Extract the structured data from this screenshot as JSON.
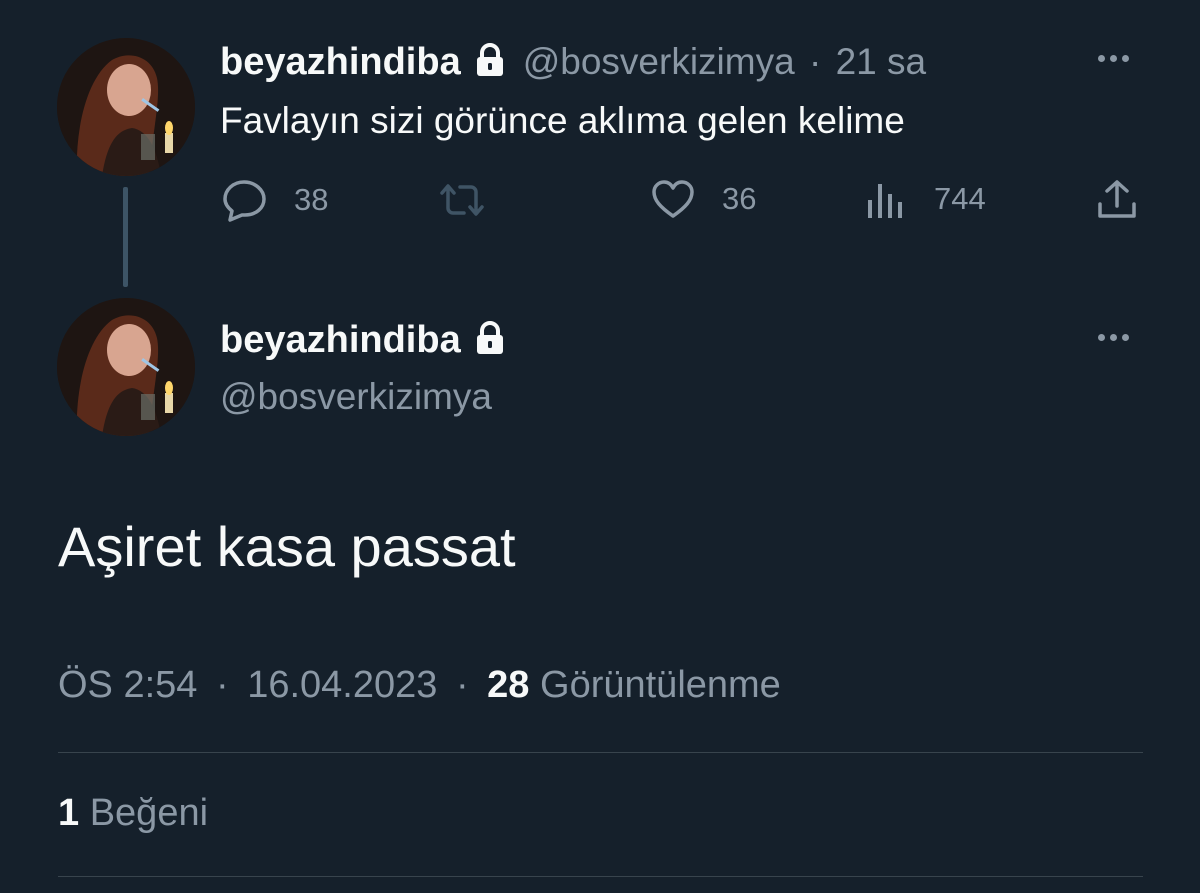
{
  "reply_tweet": {
    "display_name": "beyazhindiba",
    "handle": "@bosverkizimya",
    "separator": "·",
    "time_ago": "21 sa",
    "text": "Favlayın sizi görünce aklıma gelen kelime",
    "actions": {
      "replies": "38",
      "likes": "36",
      "views": "744"
    }
  },
  "main_tweet": {
    "display_name": "beyazhindiba",
    "handle": "@bosverkizimya",
    "text": "Aşiret kasa passat",
    "time": "ÖS 2:54",
    "separator": "·",
    "date": "16.04.2023",
    "views_count": "28",
    "views_label": "Görüntülenme",
    "likes_count": "1",
    "likes_label": "Beğeni"
  },
  "colors": {
    "background": "#15202b",
    "text": "#f7f9f9",
    "muted": "#8b98a5",
    "divider": "#38444d"
  },
  "icons": {
    "lock": "lock-icon",
    "more": "more-icon",
    "reply": "reply-icon",
    "retweet": "retweet-icon",
    "like": "heart-icon",
    "views": "analytics-icon",
    "share": "share-icon"
  }
}
